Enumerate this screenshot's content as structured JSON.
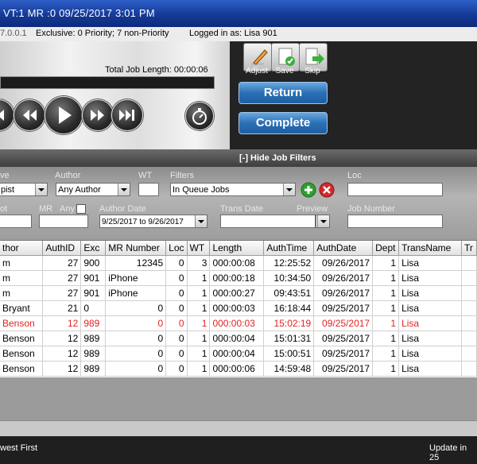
{
  "titlebar": {
    "caption": "VT:1  MR :0  09/25/2017  3:01 PM"
  },
  "infobar": {
    "version": "7.0.0.1",
    "exclusive": "Exclusive: 0 Priority; 7 non-Priority",
    "logged_in": "Logged in as: Lisa 901"
  },
  "player": {
    "total_job_length": "Total Job Length: 00:00:06"
  },
  "actions": {
    "adjust_label": "Adjust",
    "save_label": "Save",
    "skip_label": "Skip",
    "return_label": "Return",
    "complete_label": "Complete"
  },
  "filters": {
    "toggle_label": "[-] Hide Job Filters",
    "cut_label_1": "ve",
    "cut_value_1": "pist",
    "author_label": "Author",
    "author_value": "Any Author",
    "wt_label": "WT",
    "filters_label": "Filters",
    "filters_value": "In Queue Jobs",
    "loc_label": "Loc",
    "cut_label_2": "ot",
    "mr_label": "MR",
    "any_label": "Any",
    "author_date_label": "Author Date",
    "author_date_value": "9/25/2017 to 9/26/2017",
    "trans_date_label": "Trans Date",
    "preview_label": "Preview",
    "job_number_label": "Job Number"
  },
  "grid": {
    "columns": [
      "thor",
      "AuthID",
      "Exc",
      "MR Number",
      "Loc",
      "WT",
      "Length",
      "AuthTime",
      "AuthDate",
      "Dept",
      "TransName",
      "Tr"
    ],
    "rows": [
      {
        "author": "m",
        "authid": "27",
        "exc": "900",
        "mr": "12345",
        "loc": "0",
        "wt": "3",
        "length": "000:00:08",
        "authtime": "12:25:52",
        "authdate": "09/26/2017",
        "dept": "1",
        "trans": "Lisa",
        "highlight": false
      },
      {
        "author": "m",
        "authid": "27",
        "exc": "901",
        "mr": "iPhone",
        "loc": "0",
        "wt": "1",
        "length": "000:00:18",
        "authtime": "10:34:50",
        "authdate": "09/26/2017",
        "dept": "1",
        "trans": "Lisa",
        "highlight": false
      },
      {
        "author": "m",
        "authid": "27",
        "exc": "901",
        "mr": "iPhone",
        "loc": "0",
        "wt": "1",
        "length": "000:00:27",
        "authtime": "09:43:51",
        "authdate": "09/26/2017",
        "dept": "1",
        "trans": "Lisa",
        "highlight": false
      },
      {
        "author": "Bryant",
        "authid": "21",
        "exc": "0",
        "mr": "0",
        "loc": "0",
        "wt": "1",
        "length": "000:00:03",
        "authtime": "16:18:44",
        "authdate": "09/25/2017",
        "dept": "1",
        "trans": "Lisa",
        "highlight": false
      },
      {
        "author": "Benson",
        "authid": "12",
        "exc": "989",
        "mr": "0",
        "loc": "0",
        "wt": "1",
        "length": "000:00:03",
        "authtime": "15:02:19",
        "authdate": "09/25/2017",
        "dept": "1",
        "trans": "Lisa",
        "highlight": true
      },
      {
        "author": "Benson",
        "authid": "12",
        "exc": "989",
        "mr": "0",
        "loc": "0",
        "wt": "1",
        "length": "000:00:04",
        "authtime": "15:01:31",
        "authdate": "09/25/2017",
        "dept": "1",
        "trans": "Lisa",
        "highlight": false
      },
      {
        "author": "Benson",
        "authid": "12",
        "exc": "989",
        "mr": "0",
        "loc": "0",
        "wt": "1",
        "length": "000:00:04",
        "authtime": "15:00:51",
        "authdate": "09/25/2017",
        "dept": "1",
        "trans": "Lisa",
        "highlight": false
      },
      {
        "author": "Benson",
        "authid": "12",
        "exc": "989",
        "mr": "0",
        "loc": "0",
        "wt": "1",
        "length": "000:00:06",
        "authtime": "14:59:48",
        "authdate": "09/25/2017",
        "dept": "1",
        "trans": "Lisa",
        "highlight": false
      }
    ]
  },
  "status": {
    "sort": "west First",
    "update": "Update in 25"
  },
  "colors": {
    "title": "#1a46ad",
    "accent": "#2b6fb5",
    "highlight_text": "#e32222"
  }
}
